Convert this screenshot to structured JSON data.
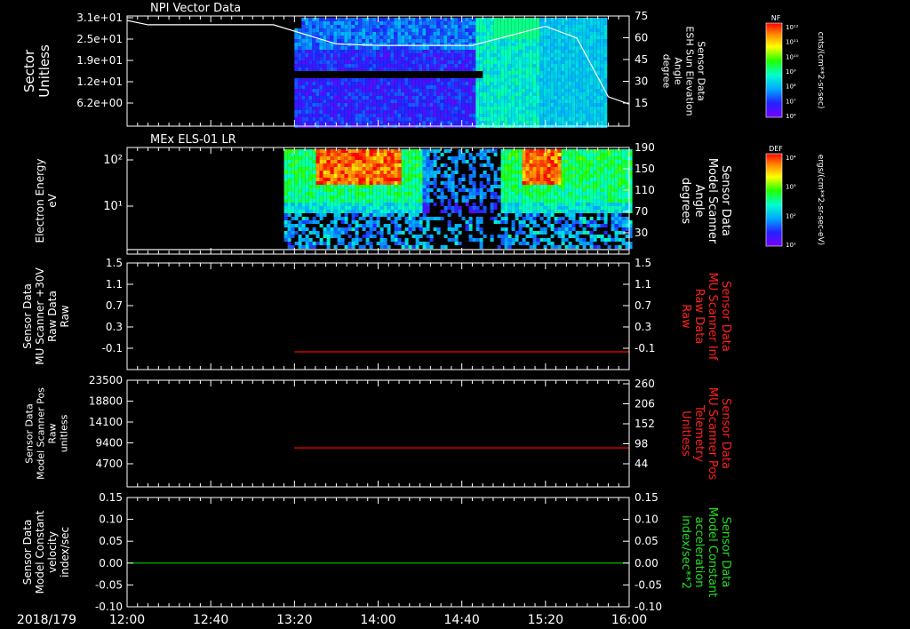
{
  "window": {
    "date_label": "2018/179",
    "time_ticks": [
      "12:00",
      "12:40",
      "13:20",
      "14:00",
      "14:40",
      "15:20",
      "16:00"
    ]
  },
  "colorbars": [
    {
      "label": "NF",
      "unit": "cnts/(cm**2-sr-sec)",
      "ticks": [
        "10¹²",
        "10¹¹",
        "10¹⁰",
        "10⁹",
        "10⁸",
        "10⁷",
        "10⁶"
      ]
    },
    {
      "label": "DEF",
      "unit": "ergs/(cm**2-sr-sec-eV)",
      "ticks": [
        "10⁴",
        "10³",
        "10²",
        "10¹"
      ]
    }
  ],
  "chart_data": [
    {
      "type": "heatmap",
      "title": "NPI Vector Data",
      "ylabel": [
        "Sector",
        "Unitless"
      ],
      "ytick_labels": [
        "3.1e+01",
        "2.5e+01",
        "1.9e+01",
        "1.2e+01",
        "6.2e+00"
      ],
      "right_ylabel": [
        "Sensor Data",
        "ESH Sun Elevation",
        "Angle",
        "degree"
      ],
      "right_ytick_labels": [
        "75",
        "60",
        "45",
        "30",
        "15"
      ],
      "right_ylim": [
        0,
        75
      ],
      "colorbar": "NF",
      "xlim": [
        "12:00",
        "16:00"
      ],
      "data_window": [
        "13:20",
        "15:49"
      ],
      "overlay_line": {
        "color": "#ffffff",
        "axis": "right",
        "x": [
          "12:00",
          "12:10",
          "13:10",
          "13:40",
          "14:00",
          "14:45",
          "15:20",
          "15:35",
          "15:50",
          "16:00"
        ],
        "y": [
          72,
          69,
          69,
          56,
          55,
          55,
          68,
          60,
          20,
          15
        ]
      }
    },
    {
      "type": "heatmap",
      "title": "MEx ELS-01 LR",
      "ylabel": [
        "Electron Energy",
        "eV"
      ],
      "ytick_labels": [
        "10²",
        "10¹"
      ],
      "yscale": "log",
      "right_ylabel": [
        "Sensor Data",
        "Model Scanner",
        "Angle",
        "degrees"
      ],
      "right_ytick_labels": [
        "190",
        "150",
        "110",
        "70",
        "30"
      ],
      "right_ylim": [
        0,
        190
      ],
      "colorbar": "DEF",
      "xlim": [
        "12:00",
        "16:00"
      ],
      "data_window": [
        "13:15",
        "16:00"
      ],
      "overlay_line": {
        "color": "#ffffff",
        "axis": "right",
        "constant": 8
      }
    },
    {
      "type": "line",
      "ylabel": [
        "Sensor Data",
        "MU Scanner +30V",
        "Raw Data",
        "Raw"
      ],
      "ytick_labels": [
        "1.5",
        "1.1",
        "0.7",
        "0.3",
        "-0.1"
      ],
      "ylim": [
        -0.3,
        1.5
      ],
      "right_ylabel": [
        "Sensor Data",
        "MU Scanner Inf",
        "Raw Data",
        "Raw"
      ],
      "right_ytick_labels": [
        "1.5",
        "1.1",
        "0.7",
        "0.3",
        "-0.1"
      ],
      "label_color": "#ff2020",
      "series": [
        {
          "color": "#ff0000",
          "x": [
            "13:20",
            "16:00"
          ],
          "y": [
            0.0,
            0.0
          ]
        }
      ]
    },
    {
      "type": "line",
      "ylabel": [
        "Sensor Data",
        "Model Scanner Pos",
        "Raw",
        "unitless"
      ],
      "ytick_labels": [
        "23500",
        "18800",
        "14100",
        "9400",
        "4700"
      ],
      "ylim": [
        0,
        23500
      ],
      "right_ylabel": [
        "Sensor Data",
        "MU Scanner Pos",
        "Telemetry",
        "Unitless"
      ],
      "right_ytick_labels": [
        "260",
        "206",
        "152",
        "98",
        "44"
      ],
      "label_color": "#ff2020",
      "series": [
        {
          "color": "#ff0000",
          "x": [
            "13:20",
            "16:00"
          ],
          "y": [
            8600,
            8600
          ]
        }
      ]
    },
    {
      "type": "line",
      "ylabel": [
        "Sensor Data",
        "Model Constant",
        "velocity",
        "index/sec"
      ],
      "ytick_labels": [
        "0.15",
        "0.10",
        "0.05",
        "0.00",
        "-0.05",
        "-0.10"
      ],
      "ylim": [
        -0.1,
        0.15
      ],
      "right_ylabel": [
        "Sensor Data",
        "Model Constant",
        "acceleration",
        "index/sec**2"
      ],
      "right_ytick_labels": [
        "0.15",
        "0.10",
        "0.05",
        "0.00",
        "-0.05",
        "-0.10"
      ],
      "label_color": "#22dd22",
      "series": [
        {
          "color": "#00cc00",
          "x": [
            "12:00",
            "16:00"
          ],
          "y": [
            0.0,
            0.0
          ]
        }
      ]
    }
  ]
}
